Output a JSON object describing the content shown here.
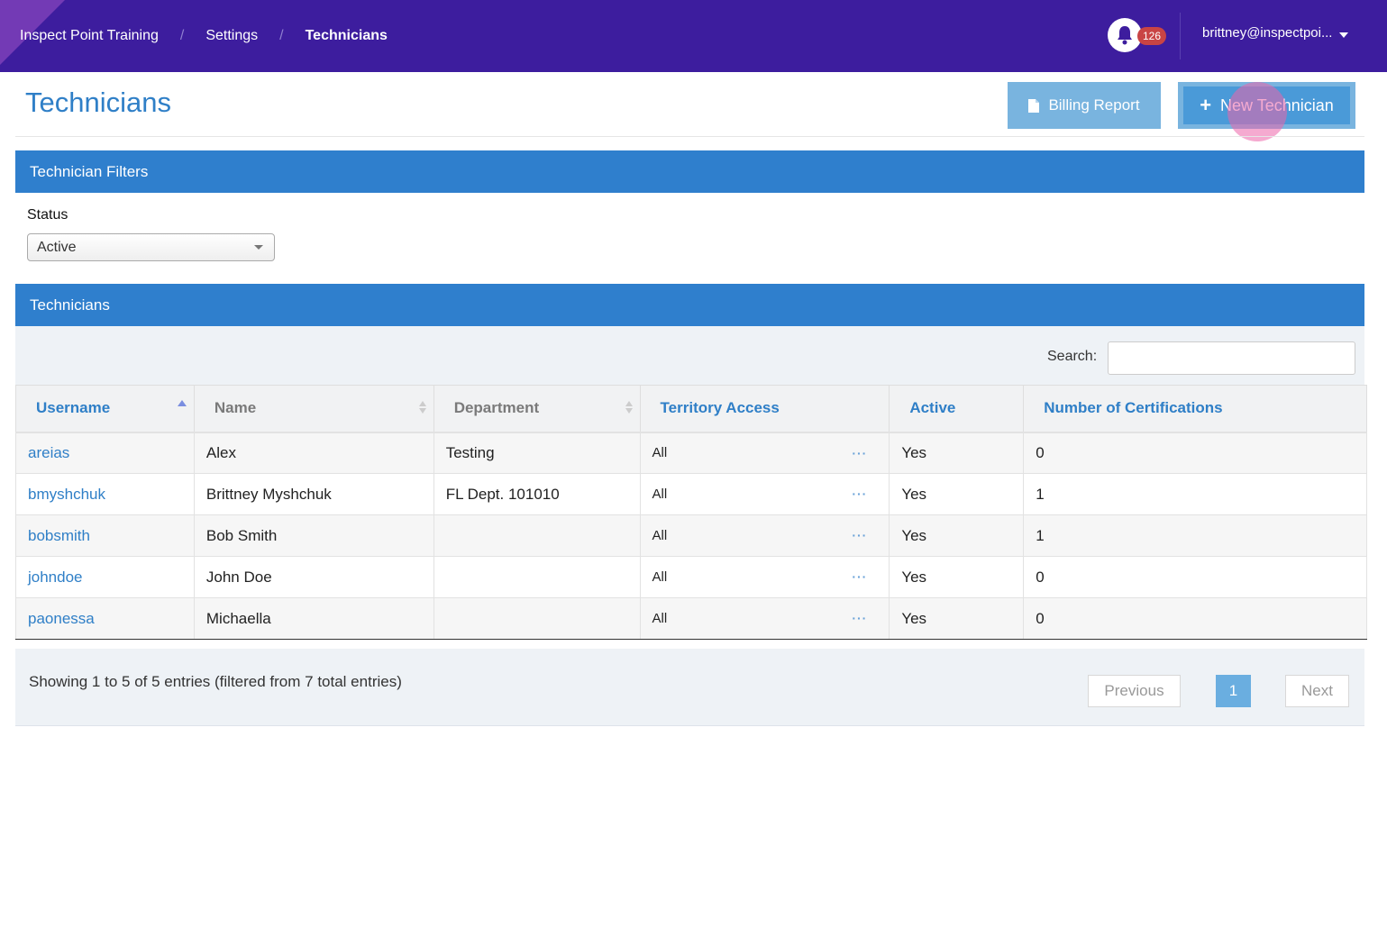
{
  "nav": {
    "breadcrumbs": [
      "Inspect Point Training",
      "Settings",
      "Technicians"
    ],
    "notification_count": "126",
    "user": "brittney@inspectpoi..."
  },
  "page": {
    "title": "Technicians",
    "billing_button": "Billing Report",
    "new_button": "New Technician"
  },
  "filters": {
    "panel_title": "Technician Filters",
    "status_label": "Status",
    "status_value": "Active"
  },
  "table": {
    "panel_title": "Technicians",
    "search_label": "Search:",
    "search_value": "",
    "columns": [
      "Username",
      "Name",
      "Department",
      "Territory Access",
      "Active",
      "Number of Certifications"
    ],
    "rows": [
      {
        "username": "areias",
        "name": "Alex",
        "department": "Testing",
        "territory": "All",
        "active": "Yes",
        "certs": "0"
      },
      {
        "username": "bmyshchuk",
        "name": "Brittney Myshchuk",
        "department": "FL Dept. 101010",
        "territory": "All",
        "active": "Yes",
        "certs": "1"
      },
      {
        "username": "bobsmith",
        "name": "Bob Smith",
        "department": "",
        "territory": "All",
        "active": "Yes",
        "certs": "1"
      },
      {
        "username": "johndoe",
        "name": "John Doe",
        "department": "",
        "territory": "All",
        "active": "Yes",
        "certs": "0"
      },
      {
        "username": "paonessa",
        "name": "Michaella",
        "department": "",
        "territory": "All",
        "active": "Yes",
        "certs": "0"
      }
    ],
    "more_glyph": "···",
    "info": "Showing 1 to 5 of 5 entries (filtered from 7 total entries)",
    "pagination": {
      "previous": "Previous",
      "current": "1",
      "next": "Next"
    }
  },
  "colors": {
    "nav_bg": "#3d1d9e",
    "accent": "#2f7fcd",
    "link": "#2f7fc7",
    "badge": "#c94444"
  },
  "icons": [
    "bell-icon",
    "caret-down-icon",
    "document-icon",
    "plus-icon",
    "sort-asc-icon",
    "sort-icon",
    "ellipsis-icon"
  ]
}
